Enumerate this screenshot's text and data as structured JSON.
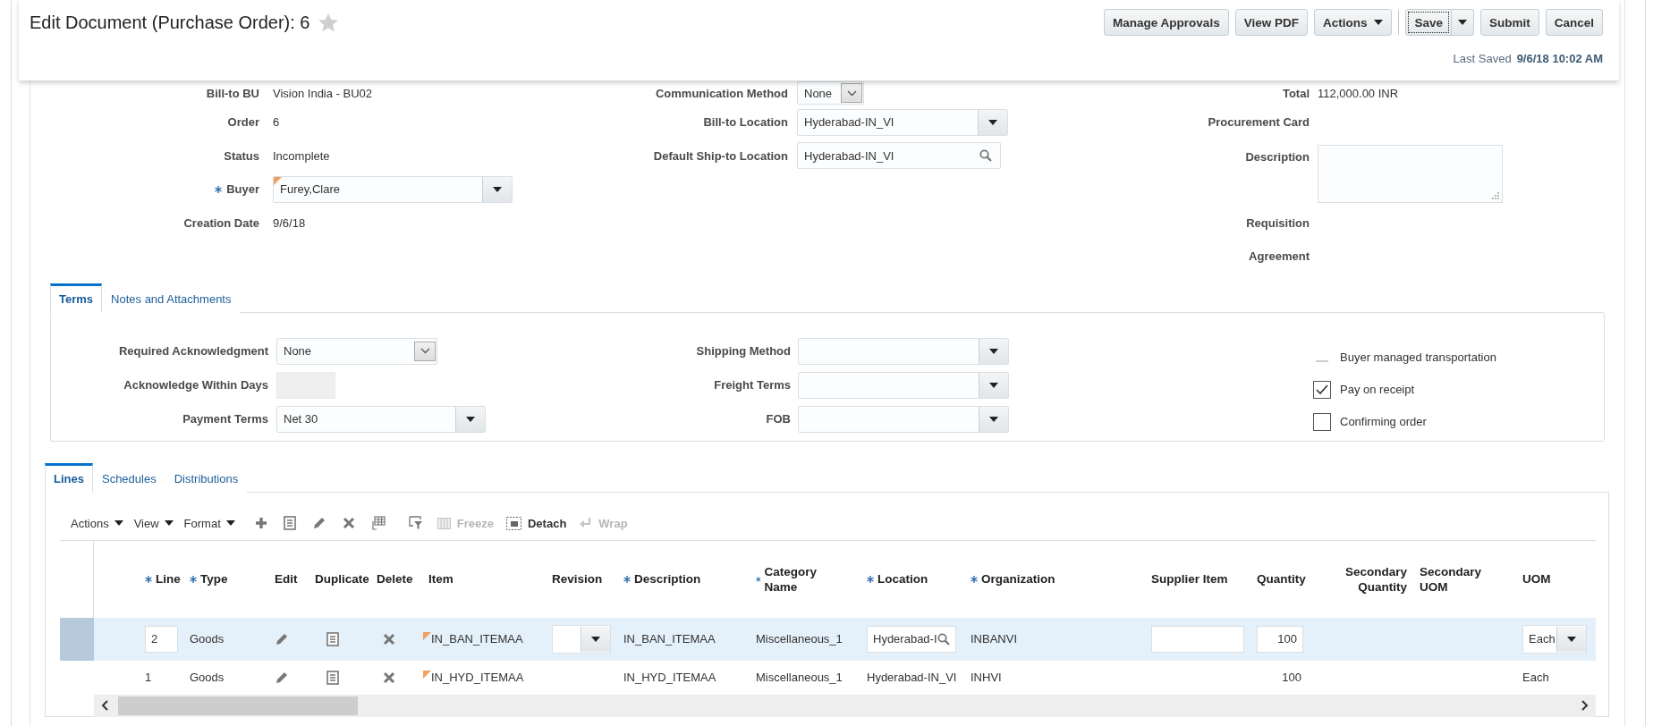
{
  "header": {
    "title": "Edit Document (Purchase Order): 6",
    "favorite": false,
    "buttons": [
      {
        "label": "Manage Approvals",
        "kind": "plain"
      },
      {
        "label": "View PDF",
        "kind": "plain"
      },
      {
        "label": "Actions",
        "kind": "menu"
      },
      {
        "label": "Save",
        "kind": "split",
        "focused": true
      },
      {
        "label": "Submit",
        "kind": "plain"
      },
      {
        "label": "Cancel",
        "kind": "plain"
      }
    ],
    "last_saved": {
      "label": "Last Saved",
      "value": "9/6/18 10:02 AM"
    }
  },
  "form": {
    "columns": [
      [
        {
          "label": "Bill-to BU",
          "kind": "text",
          "value": "Vision India - BU02"
        },
        {
          "label": "Order",
          "kind": "text",
          "value": "6"
        },
        {
          "label": "Status",
          "kind": "text",
          "value": "Incomplete"
        },
        {
          "label": "Buyer",
          "kind": "choice",
          "value": "Furey,Clare",
          "required": true,
          "modified": true
        },
        {
          "label": "Creation Date",
          "kind": "text",
          "value": "9/6/18"
        }
      ],
      [
        {
          "label": "Communication Method",
          "kind": "select",
          "value": "None"
        },
        {
          "label": "Bill-to Location",
          "kind": "choice",
          "value": "Hyderabad-IN_VI"
        },
        {
          "label": "Default Ship-to Location",
          "kind": "search",
          "value": "Hyderabad-IN_VI"
        }
      ],
      [
        {
          "label": "Total",
          "kind": "text",
          "value": "112,000.00 INR"
        },
        {
          "label": "Procurement Card",
          "kind": "text"
        },
        {
          "label": "Description",
          "kind": "textarea"
        },
        {
          "label": "Requisition",
          "kind": "text"
        },
        {
          "label": "Agreement",
          "kind": "text"
        }
      ]
    ]
  },
  "terms_tabs": [
    {
      "label": "Terms",
      "selected": true
    },
    {
      "label": "Notes and Attachments",
      "selected": false
    }
  ],
  "terms": {
    "columns": [
      [
        {
          "label": "Required Acknowledgment",
          "kind": "select",
          "value": "None"
        },
        {
          "label": "Acknowledge Within Days",
          "kind": "disabled"
        },
        {
          "label": "Payment Terms",
          "kind": "choice",
          "value": "Net 30"
        }
      ],
      [
        {
          "label": "Shipping Method",
          "kind": "choice"
        },
        {
          "label": "Freight Terms",
          "kind": "choice"
        },
        {
          "label": "FOB",
          "kind": "choice"
        }
      ]
    ],
    "options": [
      {
        "label": "Buyer managed transportation",
        "kind": "readonly",
        "checked": false
      },
      {
        "label": "Pay on receipt",
        "kind": "checkbox",
        "checked": true
      },
      {
        "label": "Confirming order",
        "kind": "checkbox",
        "checked": false
      }
    ]
  },
  "lines_tabs": [
    {
      "label": "Lines",
      "selected": true
    },
    {
      "label": "Schedules",
      "selected": false
    },
    {
      "label": "Distributions",
      "selected": false
    }
  ],
  "toolbar": {
    "menus": [
      "Actions",
      "View",
      "Format"
    ],
    "text_buttons": [
      {
        "label": "Freeze",
        "kind": "freeze",
        "disabled": true
      },
      {
        "label": "Detach",
        "kind": "detach",
        "disabled": false
      },
      {
        "label": "Wrap",
        "kind": "wrap",
        "disabled": true
      }
    ]
  },
  "table": {
    "columns": [
      {
        "label": "Line",
        "required": true
      },
      {
        "label": "Type",
        "required": true
      },
      {
        "label": "Edit",
        "required": false
      },
      {
        "label": "Duplicate",
        "required": false
      },
      {
        "label": "Delete",
        "required": false
      },
      {
        "label": "Item",
        "required": false
      },
      {
        "label": "Revision",
        "required": false
      },
      {
        "label": "Description",
        "required": true
      },
      {
        "label": "Category Name",
        "required": true
      },
      {
        "label": "Location",
        "required": true
      },
      {
        "label": "Organization",
        "required": true
      },
      {
        "label": "Supplier Item",
        "required": false
      },
      {
        "label": "Quantity",
        "required": false
      },
      {
        "label": "Secondary Quantity",
        "required": false
      },
      {
        "label": "Secondary UOM",
        "required": false
      },
      {
        "label": "UOM",
        "required": false
      }
    ],
    "rows": [
      {
        "selected": true,
        "line": "2",
        "type": "Goods",
        "item": "IN_BAN_ITEMAA",
        "item_modified": true,
        "description": "IN_BAN_ITEMAA",
        "category": "Miscellaneous_1",
        "location": "Hyderabad-I",
        "organization": "INBANVI",
        "quantity": "100",
        "uom": "Each"
      },
      {
        "selected": false,
        "line": "1",
        "type": "Goods",
        "item": "IN_HYD_ITEMAA",
        "item_modified": true,
        "description": "IN_HYD_ITEMAA",
        "category": "Miscellaneous_1",
        "location": "Hyderabad-IN_VI",
        "organization": "INHVI",
        "quantity": "100",
        "uom": "Each"
      }
    ]
  }
}
